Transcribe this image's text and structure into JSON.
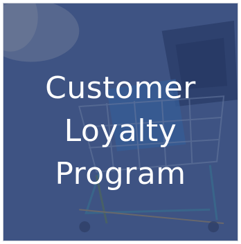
{
  "tile": {
    "headline_lines": [
      "Customer",
      "Loyalty",
      "Program"
    ]
  },
  "colors": {
    "overlay": "#3a4f7e",
    "text": "#ffffff"
  },
  "icons": {
    "background": "shopping-cart-photo"
  }
}
